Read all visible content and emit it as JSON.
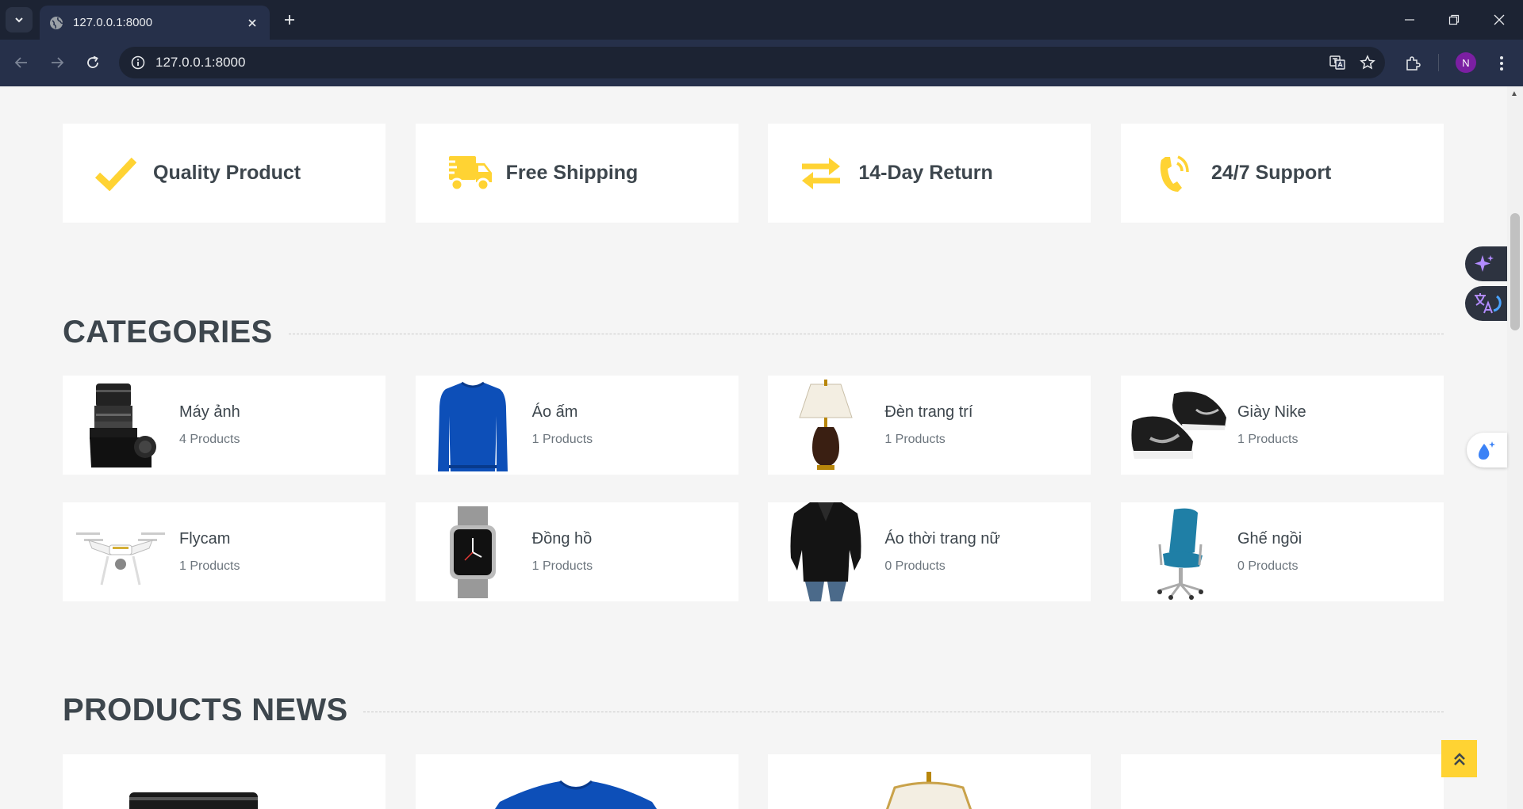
{
  "browser": {
    "tab_title": "127.0.0.1:8000",
    "url": "127.0.0.1:8000",
    "avatar_letter": "N"
  },
  "features": [
    {
      "icon": "check-icon",
      "label": "Quality Product"
    },
    {
      "icon": "shipping-truck-icon",
      "label": "Free Shipping"
    },
    {
      "icon": "exchange-arrows-icon",
      "label": "14-Day Return"
    },
    {
      "icon": "phone-volume-icon",
      "label": "24/7 Support"
    }
  ],
  "sections": {
    "categories_title": "CATEGORIES",
    "products_title": "PRODUCTS NEWS"
  },
  "categories": [
    {
      "name": "Máy ảnh",
      "count": "4 Products",
      "image": "camera"
    },
    {
      "name": "Áo ấm",
      "count": "1 Products",
      "image": "blue-sweater"
    },
    {
      "name": "Đèn trang trí",
      "count": "1 Products",
      "image": "table-lamp"
    },
    {
      "name": "Giày Nike",
      "count": "1 Products",
      "image": "nike-shoes"
    },
    {
      "name": "Flycam",
      "count": "1 Products",
      "image": "drone"
    },
    {
      "name": "Đồng hồ",
      "count": "1 Products",
      "image": "smartwatch"
    },
    {
      "name": "Áo thời trang nữ",
      "count": "0 Products",
      "image": "women-blouse"
    },
    {
      "name": "Ghế ngồi",
      "count": "0 Products",
      "image": "office-chair"
    }
  ],
  "colors": {
    "accent": "#ffd333",
    "text_dark": "#3d464d",
    "text_muted": "#6c757d",
    "page_bg": "#f5f5f5"
  }
}
